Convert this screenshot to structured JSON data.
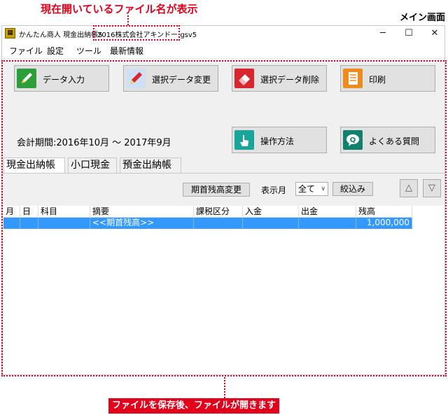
{
  "annotations": {
    "top_note": "現在開いているファイル名が表示",
    "screen_label": "メイン画面",
    "bottom_note": "ファイルを保存後、ファイルが開きます"
  },
  "window": {
    "app_title": "かんたん商人 現金出納帳5",
    "file_name": "2016株式会社アキンドー.gsv5",
    "controls": {
      "minimize": "─",
      "maximize": "☐",
      "close": "✕"
    }
  },
  "menu": [
    "ファイル",
    "設定",
    "ツール",
    "最新情報"
  ],
  "actions": [
    {
      "label": "データ入力",
      "icon": "pencil-icon",
      "color": "#2e9e3a"
    },
    {
      "label": "選択データ変更",
      "icon": "edit-pencil-icon",
      "color": "#3a7fd0"
    },
    {
      "label": "選択データ削除",
      "icon": "eraser-icon",
      "color": "#d9262e"
    },
    {
      "label": "印刷",
      "icon": "print-icon",
      "color": "#f08a1c"
    },
    {
      "label": "操作方法",
      "icon": "hand-pointer-icon",
      "color": "#1aa59a"
    },
    {
      "label": "よくある質問",
      "icon": "question-bubble-icon",
      "color": "#12806f"
    }
  ],
  "period": "会計期間:2016年10月 〜 2017年9月",
  "tabs": [
    "現金出納帳",
    "小口現金",
    "預金出納帳"
  ],
  "toolbar": {
    "opening_balance_button": "期首残高変更",
    "month_label": "表示月",
    "month_value": "全て",
    "filter_button": "絞込み",
    "up_arrow": "△",
    "down_arrow": "▽"
  },
  "table": {
    "columns": [
      "月",
      "日",
      "科目",
      "摘要",
      "課税区分",
      "入金",
      "出金",
      "残高"
    ],
    "rows": [
      [
        "",
        "",
        "",
        "<<期首残高>>",
        "",
        "",
        "",
        "1,000,000"
      ]
    ]
  },
  "colors": {
    "accent_red": "#e3001b",
    "selection_blue": "#3399ff"
  }
}
